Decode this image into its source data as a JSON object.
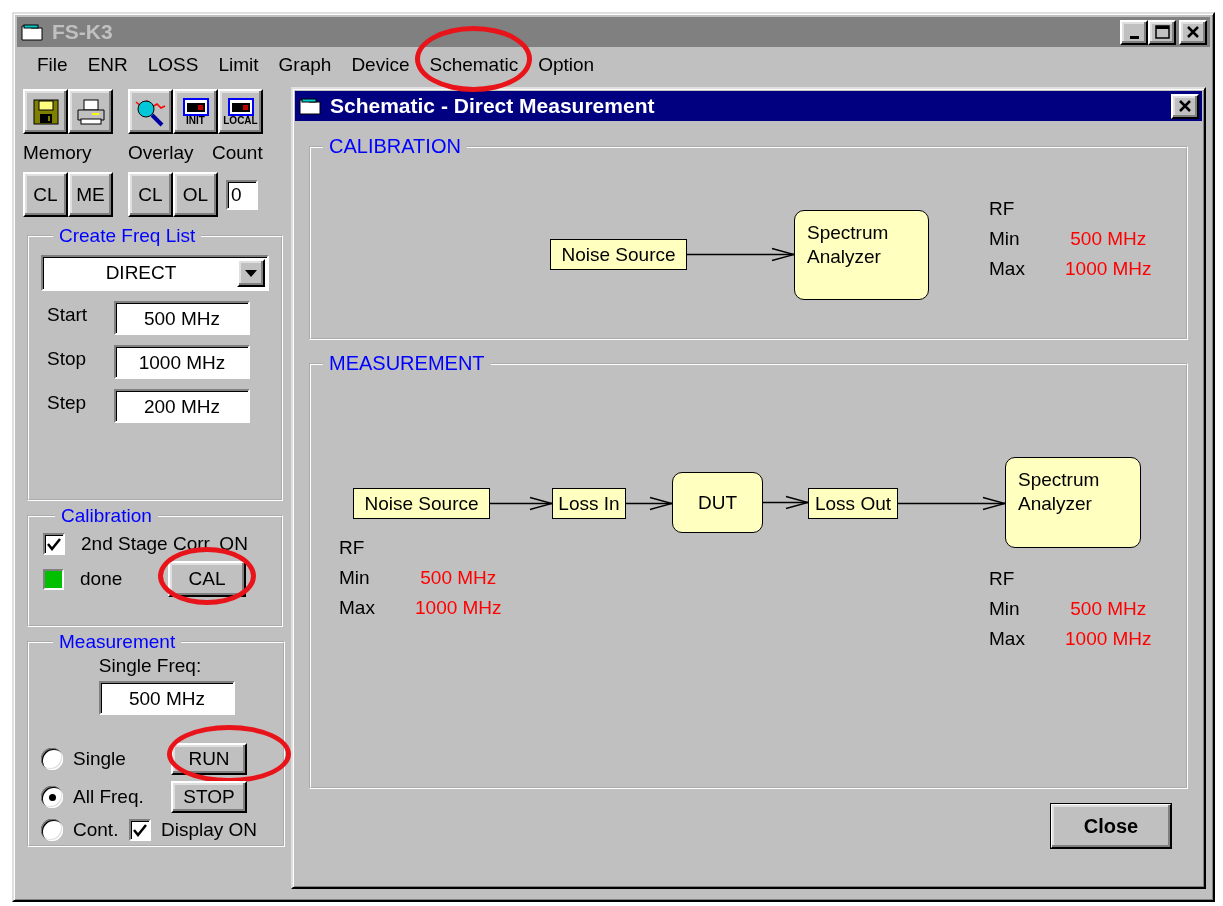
{
  "window": {
    "title": "FS-K3"
  },
  "menu": [
    {
      "label": "File",
      "highlighted": false
    },
    {
      "label": "ENR",
      "highlighted": false
    },
    {
      "label": "LOSS",
      "highlighted": false
    },
    {
      "label": "Limit",
      "highlighted": false
    },
    {
      "label": "Graph",
      "highlighted": false
    },
    {
      "label": "Device",
      "highlighted": false
    },
    {
      "label": "Schematic",
      "highlighted": true
    },
    {
      "label": "Option",
      "highlighted": false
    }
  ],
  "toolbar": [
    {
      "kind": "disk"
    },
    {
      "kind": "printer"
    },
    {
      "kind": "gap"
    },
    {
      "kind": "magnifier"
    },
    {
      "kind": "device",
      "label": "INIT"
    },
    {
      "kind": "device",
      "label": "LOCAL"
    }
  ],
  "memory": {
    "label": "Memory",
    "buttons": [
      "CL",
      "ME"
    ]
  },
  "overlay": {
    "label": "Overlay",
    "buttons": [
      "CL",
      "OL"
    ]
  },
  "count": {
    "label": "Count",
    "value": "0"
  },
  "freq_list": {
    "title": "Create Freq List",
    "mode": "DIRECT",
    "fields": [
      {
        "label": "Start",
        "value": "500 MHz"
      },
      {
        "label": "Stop",
        "value": "1000 MHz"
      },
      {
        "label": "Step",
        "value": "200 MHz"
      }
    ]
  },
  "calibration": {
    "title": "Calibration",
    "second_stage": {
      "label": "2nd Stage Corr. ON",
      "checked": true
    },
    "status": {
      "label": "done",
      "done": true
    },
    "button": {
      "label": "CAL",
      "highlighted": true
    }
  },
  "measurement": {
    "title": "Measurement",
    "single_freq": {
      "label": "Single Freq:",
      "value": "500 MHz"
    },
    "modes": [
      {
        "label": "Single",
        "selected": false
      },
      {
        "label": "All Freq.",
        "selected": true
      },
      {
        "label": "Cont.",
        "selected": false
      }
    ],
    "buttons": [
      {
        "label": "RUN",
        "highlighted": true
      },
      {
        "label": "STOP",
        "highlighted": false
      }
    ],
    "display": {
      "label": "Display ON",
      "checked": true
    }
  },
  "schematic": {
    "title": "Schematic - Direct Measurement",
    "sections": [
      {
        "kind": "calibration",
        "title": "CALIBRATION",
        "nodes": [
          {
            "kind": "block",
            "label": "Noise Source"
          },
          {
            "kind": "device",
            "label": "Spectrum Analyzer"
          }
        ],
        "readouts": [
          {
            "heading": "RF",
            "rows": [
              {
                "label": "Min",
                "value": "500 MHz"
              },
              {
                "label": "Max",
                "value": "1000 MHz"
              }
            ]
          }
        ]
      },
      {
        "kind": "measurement",
        "title": "MEASUREMENT",
        "nodes": [
          {
            "kind": "block",
            "label": "Noise Source"
          },
          {
            "kind": "block",
            "label": "Loss In"
          },
          {
            "kind": "device",
            "label": "DUT"
          },
          {
            "kind": "block",
            "label": "Loss Out"
          },
          {
            "kind": "device",
            "label": "Spectrum Analyzer"
          }
        ],
        "readouts": [
          {
            "heading": "RF",
            "rows": [
              {
                "label": "Min",
                "value": "500 MHz"
              },
              {
                "label": "Max",
                "value": "1000 MHz"
              }
            ]
          },
          {
            "heading": "RF",
            "rows": [
              {
                "label": "Min",
                "value": "500 MHz"
              },
              {
                "label": "Max",
                "value": "1000 MHz"
              }
            ]
          }
        ]
      }
    ],
    "close": "Close"
  }
}
